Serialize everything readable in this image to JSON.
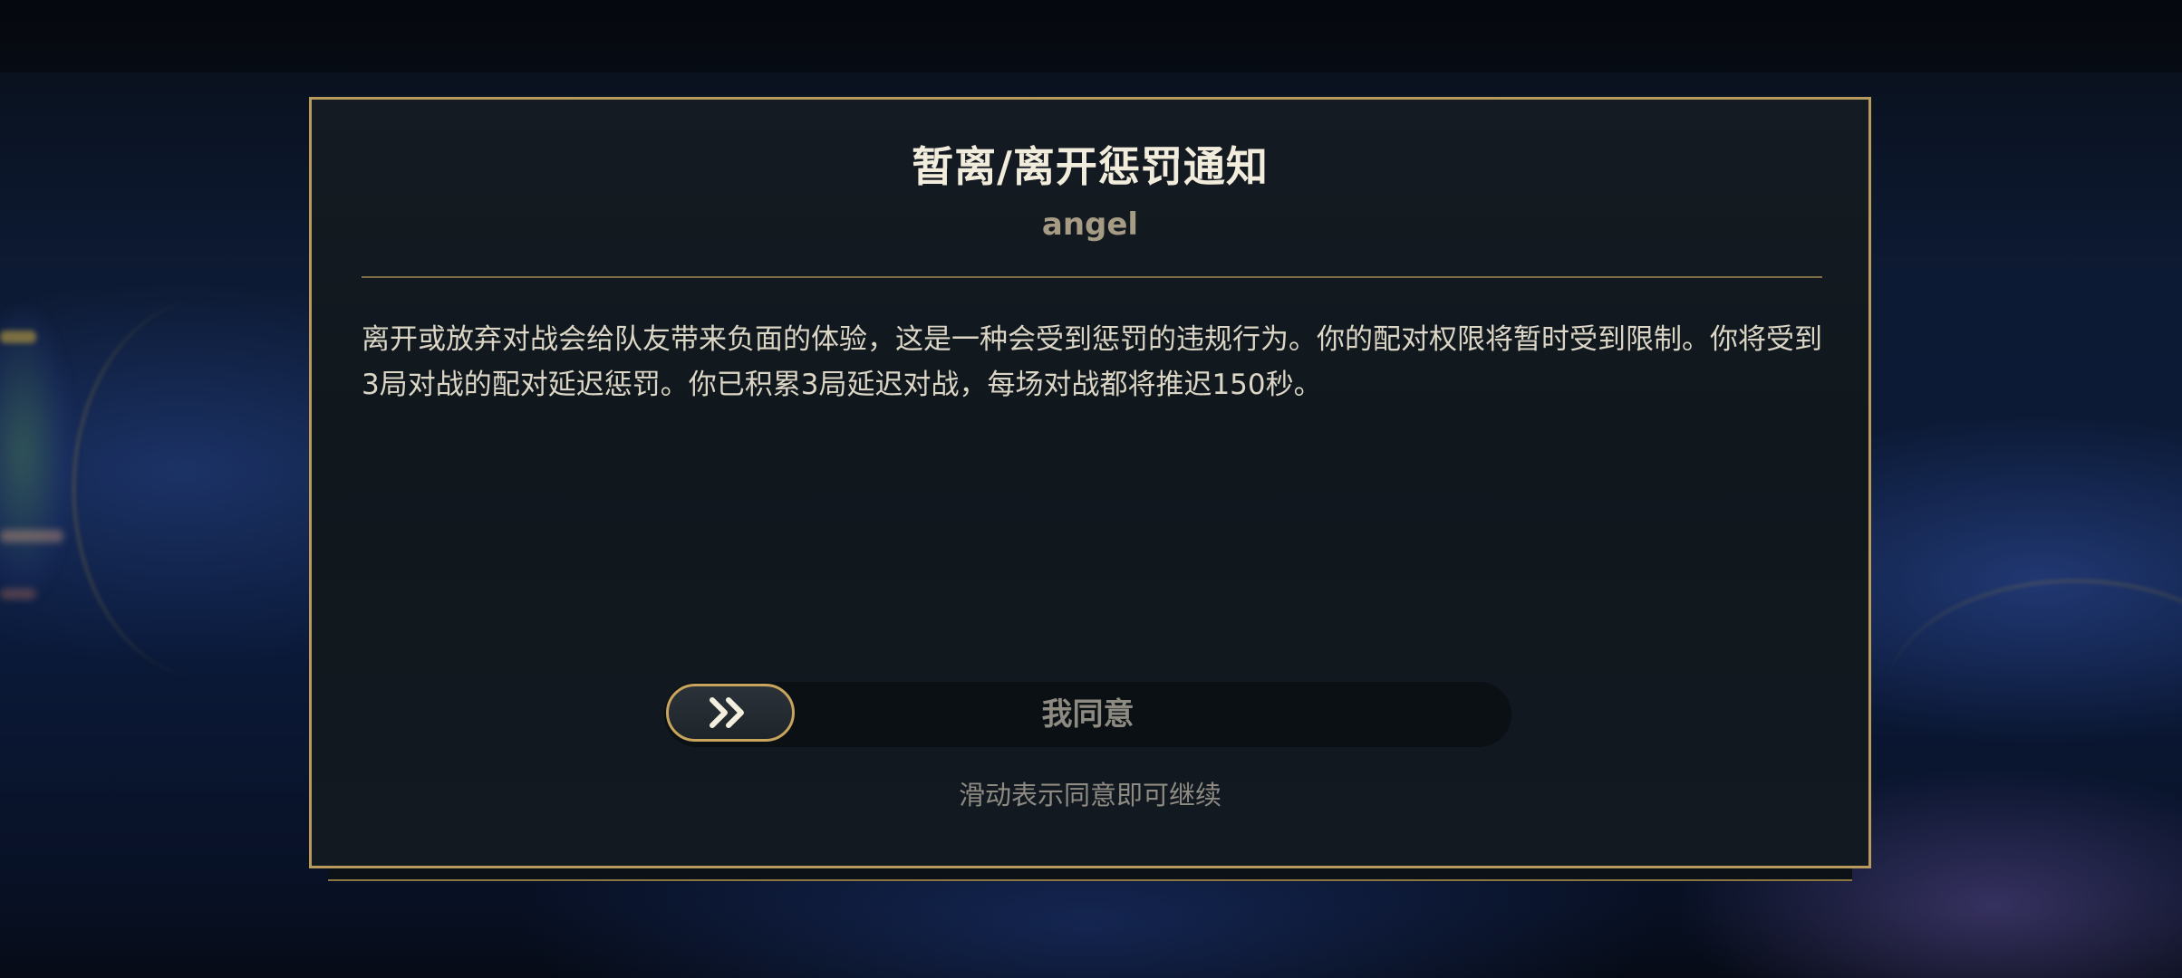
{
  "dialog": {
    "title": "暂离/离开惩罚通知",
    "subtitle": "angel",
    "body": "离开或放弃对战会给队友带来负面的体验，这是一种会受到惩罚的违规行为。你的配对权限将暂时受到限制。你将受到3局对战的配对延迟惩罚。你已积累3局延迟对战，每场对战都将推迟150秒。"
  },
  "slider": {
    "handle_icon": "double-chevron-right-icon",
    "label": "我同意",
    "hint": "滑动表示同意即可继续",
    "progress": 0
  },
  "colors": {
    "accent_gold": "#b89a5c",
    "title_text": "#f2ecdc",
    "body_text": "#dcd6c6",
    "muted_text": "#8e8b83",
    "panel_bg": "#121920"
  }
}
